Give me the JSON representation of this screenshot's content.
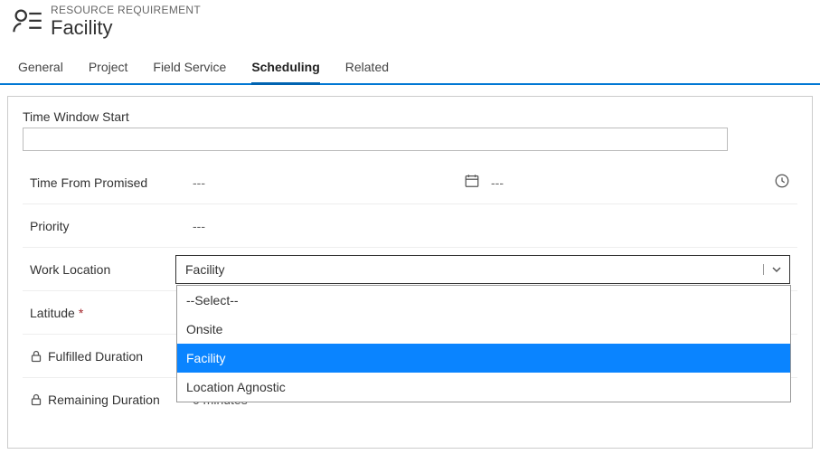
{
  "header": {
    "breadcrumb": "RESOURCE REQUIREMENT",
    "title": "Facility"
  },
  "tabs": [
    {
      "label": "General"
    },
    {
      "label": "Project"
    },
    {
      "label": "Field Service"
    },
    {
      "label": "Scheduling",
      "active": true
    },
    {
      "label": "Related"
    }
  ],
  "form": {
    "time_window_start": {
      "label": "Time Window Start",
      "value": ""
    },
    "time_from_promised": {
      "label": "Time From Promised",
      "date": "---",
      "time": "---"
    },
    "priority": {
      "label": "Priority",
      "value": "---"
    },
    "work_location": {
      "label": "Work Location",
      "value": "Facility",
      "options": [
        "--Select--",
        "Onsite",
        "Facility",
        "Location Agnostic"
      ],
      "highlighted": "Facility"
    },
    "latitude": {
      "label": "Latitude"
    },
    "fulfilled_duration": {
      "label": "Fulfilled Duration"
    },
    "remaining_duration": {
      "label": "Remaining Duration",
      "obscured_value": "0 minutes"
    }
  }
}
